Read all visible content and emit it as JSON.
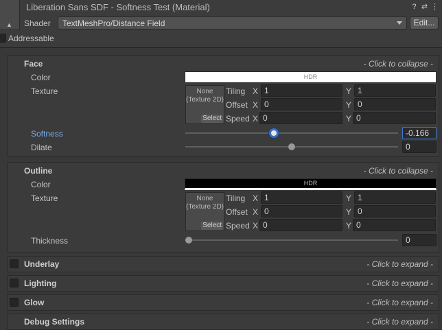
{
  "header": {
    "title": "Liberation Sans SDF - Softness Test (Material)",
    "thumb_caption": "▲",
    "icons": [
      "help-icon",
      "preset-icon",
      "menu-icon"
    ],
    "help_glyph": "?",
    "preset_glyph": "⇄",
    "menu_glyph": "⋮",
    "shader_label": "Shader",
    "shader_value": "TextMeshPro/Distance Field",
    "edit_label": "Edit...",
    "addressable_label": "Addressable"
  },
  "face": {
    "title": "Face",
    "collapse_note": "- Click to collapse -",
    "color_label": "Color",
    "color_hdr": "HDR",
    "color_value": "#ffffff",
    "texture_label": "Texture",
    "texture_none": "None (Texture 2D)",
    "texture_select": "Select",
    "tiling_label": "Tiling",
    "offset_label": "Offset",
    "speed_label": "Speed",
    "x_label": "X",
    "y_label": "Y",
    "tiling_x": "1",
    "tiling_y": "1",
    "offset_x": "0",
    "offset_y": "0",
    "speed_x": "0",
    "speed_y": "0",
    "softness_label": "Softness",
    "softness_value": "-0.166",
    "softness_fraction": 0.417,
    "dilate_label": "Dilate",
    "dilate_value": "0",
    "dilate_fraction": 0.5
  },
  "outline": {
    "title": "Outline",
    "collapse_note": "- Click to collapse -",
    "color_label": "Color",
    "color_hdr": "HDR",
    "color_value": "#000000",
    "texture_label": "Texture",
    "texture_none": "None (Texture 2D)",
    "texture_select": "Select",
    "tiling_label": "Tiling",
    "offset_label": "Offset",
    "speed_label": "Speed",
    "x_label": "X",
    "y_label": "Y",
    "tiling_x": "1",
    "tiling_y": "1",
    "offset_x": "0",
    "offset_y": "0",
    "speed_x": "0",
    "speed_y": "0",
    "thickness_label": "Thickness",
    "thickness_value": "0",
    "thickness_fraction": 0.0
  },
  "foldouts": [
    {
      "name": "Underlay",
      "note": "- Click to expand -"
    },
    {
      "name": "Lighting",
      "note": "- Click to expand -"
    },
    {
      "name": "Glow",
      "note": "- Click to expand -"
    },
    {
      "name": "Debug Settings",
      "note": "- Click to expand -"
    }
  ],
  "colors": {
    "background": "#383838",
    "accent": "#3f7ad1",
    "active_label": "#7ba8e6"
  }
}
